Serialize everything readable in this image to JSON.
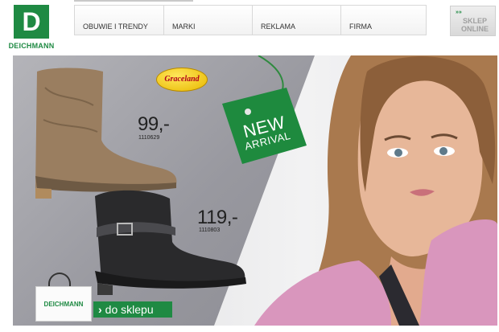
{
  "logo": {
    "letter": "D",
    "name": "DEICHMANN"
  },
  "nav": {
    "items": [
      {
        "label": "OBUWIE I TRENDY"
      },
      {
        "label": "MARKI"
      },
      {
        "label": "REKLAMA"
      },
      {
        "label": "FIRMA"
      }
    ]
  },
  "shop_button": {
    "arrows": "»»",
    "label": "SKLEP ONLINE"
  },
  "banner": {
    "brand_badge": "Graceland",
    "tag": {
      "line1": "NEW",
      "line2": "ARRIVAL"
    },
    "products": [
      {
        "price": "99,-",
        "code": "1110629"
      },
      {
        "price": "119,-",
        "code": "1110803"
      }
    ],
    "bag_label": "DEICHMANN",
    "cta": {
      "arrow": "›",
      "label": "do sklepu"
    }
  },
  "colors": {
    "brand_green": "#1f8a43",
    "banner_gray": "#9c9ca2",
    "badge_yellow": "#f2cc1a"
  }
}
